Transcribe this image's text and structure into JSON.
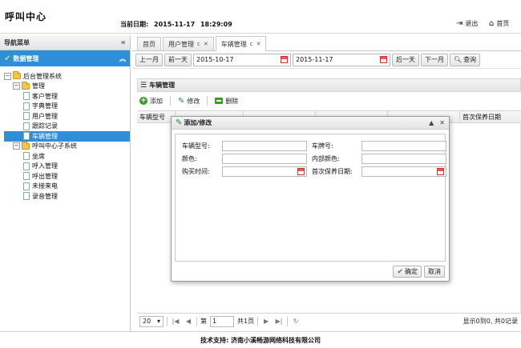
{
  "header": {
    "app_title": "呼叫中心",
    "date_label": "当前日期:",
    "date_value": "2015-11-17",
    "time_value": "18:29:09",
    "logout_label": "退出",
    "home_label": "首页"
  },
  "sidebar": {
    "title": "导航菜单",
    "active_section": "数据管理",
    "tree": [
      {
        "label": "后台管理系统",
        "type": "folder",
        "level": 1
      },
      {
        "label": "管理",
        "type": "folder",
        "level": 2
      },
      {
        "label": "客户管理",
        "type": "file",
        "level": 3
      },
      {
        "label": "字典管理",
        "type": "file",
        "level": 3
      },
      {
        "label": "用户管理",
        "type": "file",
        "level": 3
      },
      {
        "label": "跟踪记录",
        "type": "file",
        "level": 3
      },
      {
        "label": "车辆管理",
        "type": "file",
        "level": 3,
        "selected": true
      },
      {
        "label": "呼叫中心子系统",
        "type": "folder",
        "level": 2
      },
      {
        "label": "坐席",
        "type": "file",
        "level": 3
      },
      {
        "label": "呼入管理",
        "type": "file",
        "level": 3
      },
      {
        "label": "呼出管理",
        "type": "file",
        "level": 3
      },
      {
        "label": "未接来电",
        "type": "file",
        "level": 3
      },
      {
        "label": "录音管理",
        "type": "file",
        "level": 3
      }
    ]
  },
  "tabs": [
    {
      "label": "首页",
      "closable": false
    },
    {
      "label": "用户管理",
      "closable": true
    },
    {
      "label": "车辆管理",
      "closable": true,
      "active": true
    }
  ],
  "filter": {
    "prev_month": "上一月",
    "prev_day": "前一天",
    "start_date": "2015-10-17",
    "end_date": "2015-11-17",
    "next_day": "后一天",
    "next_month": "下一月",
    "query": "查询"
  },
  "panel": {
    "title": "车辆管理",
    "add": "添加",
    "edit": "修改",
    "delete": "删除",
    "columns": [
      "车辆型号",
      "",
      "",
      "",
      "",
      "首次保养日期"
    ]
  },
  "pager": {
    "page_size": "20",
    "page_prefix": "第",
    "page_value": "1",
    "page_suffix": "共1页",
    "info": "显示0到0, 共0记录"
  },
  "dialog": {
    "title": "添加/修改",
    "fields": {
      "model_label": "车辆型号:",
      "plate_label": "车牌号:",
      "color_label": "颜色:",
      "inner_color_label": "内部颜色:",
      "purchase_label": "购买时间:",
      "first_maint_label": "首次保养日期:"
    },
    "ok": "确定",
    "cancel": "取消"
  },
  "footer": {
    "text": "技术支持: 济南小溪畅游网络科技有限公司"
  }
}
